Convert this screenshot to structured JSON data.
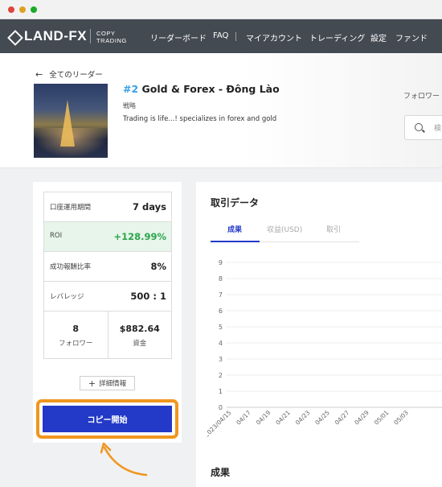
{
  "nav": {
    "logo_text": "LAND-FX",
    "logo_sub_1": "COPY",
    "logo_sub_2": "TRADING",
    "items": [
      {
        "label": "リーダーボード"
      },
      {
        "label": "FAQ"
      },
      {
        "label": "マイアカウント"
      },
      {
        "label": "トレーディング"
      },
      {
        "label": "設定"
      },
      {
        "label": "ファンド"
      }
    ]
  },
  "header": {
    "back_label": "全てのリーダー",
    "rank": "#2",
    "leader_name": "Gold & Forex - Đông Lào",
    "strategy_label": "戦略",
    "strategy_desc": "Trading is life...! specializes in forex and gold",
    "follow_label": "フォロワー",
    "search_placeholder": "検"
  },
  "stats": {
    "rows": [
      {
        "label": "口座運用期間",
        "value": "7 days"
      },
      {
        "label": "ROI",
        "value": "+128.99%"
      },
      {
        "label": "成功報酬比率",
        "value": "8%"
      },
      {
        "label": "レバレッジ",
        "value": "500 : 1"
      }
    ],
    "followers": {
      "value": "8",
      "label": "フォロワー"
    },
    "funds": {
      "value": "$882.64",
      "label": "資金"
    },
    "detail_button": "詳細情報",
    "copy_button": "コピー開始"
  },
  "trading_data": {
    "title": "取引データ",
    "tabs": [
      {
        "label": "成果",
        "active": true
      },
      {
        "label": "収益(USD)",
        "active": false
      },
      {
        "label": "取引",
        "active": false
      }
    ],
    "result_title": "成果"
  },
  "colors": {
    "nav_bg": "#444a52",
    "accent_blue": "#2339c7",
    "roi_green": "#2da44e",
    "highlight_orange": "#f0961e"
  },
  "chart_data": {
    "type": "line",
    "x": [
      "2023/04/15",
      "04/17",
      "04/19",
      "04/21",
      "04/23",
      "04/25",
      "04/27",
      "04/29",
      "05/01",
      "05/03"
    ],
    "y_ticks": [
      "0",
      "1",
      "2",
      "3",
      "4",
      "5",
      "6",
      "7",
      "8",
      "9"
    ],
    "ylim": [
      0,
      9
    ],
    "grid": true,
    "series": []
  }
}
